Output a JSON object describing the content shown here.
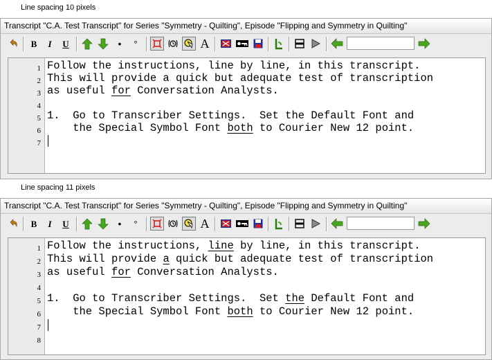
{
  "panels": [
    {
      "caption": "Line spacing 10 pixels",
      "window_title": "Transcript \"C.A. Test Transcript\" for Series \"Symmetry - Quilting\", Episode \"Flipping and Symmetry in Quilting\"",
      "toolbar": {
        "bold": "B",
        "italic": "I",
        "underline": "U",
        "dot": "•",
        "degree": "°",
        "font_a": "A",
        "position_value": ""
      },
      "line_numbers": [
        "1",
        "2",
        "3",
        "4",
        "5",
        "6",
        "7"
      ],
      "lines": [
        [
          {
            "t": "Follow the instructions, line by line, in this transcript."
          }
        ],
        [
          {
            "t": "This will provide a quick but adequate test of transcription"
          }
        ],
        [
          {
            "t": "as useful "
          },
          {
            "t": "for",
            "u": true
          },
          {
            "t": " Conversation Analysts."
          }
        ],
        [
          {
            "t": ""
          }
        ],
        [
          {
            "t": "1.  Go to Transcriber Settings.  Set the Default Font and"
          }
        ],
        [
          {
            "t": "    the Special Symbol Font "
          },
          {
            "t": "both",
            "u": true
          },
          {
            "t": " to Courier New 12 point."
          }
        ],
        [
          {
            "t": ""
          }
        ]
      ]
    },
    {
      "caption": "Line spacing 11 pixels",
      "window_title": "Transcript \"C.A. Test Transcript\" for Series \"Symmetry - Quilting\", Episode \"Flipping and Symmetry in Quilting\"",
      "toolbar": {
        "bold": "B",
        "italic": "I",
        "underline": "U",
        "dot": "•",
        "degree": "°",
        "font_a": "A",
        "position_value": ""
      },
      "line_numbers": [
        "1",
        "2",
        "3",
        "4",
        "5",
        "6",
        "7",
        "8"
      ],
      "lines": [
        [
          {
            "t": "Follow the instructions, "
          },
          {
            "t": "line",
            "u": true
          },
          {
            "t": " by line, in this transcript."
          }
        ],
        [
          {
            "t": "This will provide "
          },
          {
            "t": "a",
            "u": true
          },
          {
            "t": " quick but adequate test of transcription"
          }
        ],
        [
          {
            "t": "as useful "
          },
          {
            "t": "for",
            "u": true
          },
          {
            "t": " Conversation Analysts."
          }
        ],
        [
          {
            "t": ""
          }
        ],
        [
          {
            "t": "1.  Go to Transcriber Settings.  Set "
          },
          {
            "t": "the",
            "u": true
          },
          {
            "t": " Default Font and"
          }
        ],
        [
          {
            "t": "    the Special Symbol Font "
          },
          {
            "t": "both",
            "u": true
          },
          {
            "t": " to Courier New 12 point."
          }
        ],
        [
          {
            "t": ""
          }
        ],
        [
          {
            "t": ""
          }
        ]
      ]
    }
  ],
  "icons": [
    "undo-icon",
    "bold-icon",
    "italic-icon",
    "underline-icon",
    "rising-intonation-icon",
    "falling-intonation-icon",
    "dot-icon",
    "degree-icon",
    "overlap-icon",
    "timestamp-icon",
    "highlight-icon",
    "font-icon",
    "video-icon",
    "key-icon",
    "save-icon",
    "bookmark-icon",
    "split-icon",
    "play-icon",
    "back-icon",
    "forward-icon"
  ],
  "colors": {
    "green_arrow": "#4aa520",
    "red_icon": "#d42020",
    "navy_icon": "#1c2f9a"
  }
}
